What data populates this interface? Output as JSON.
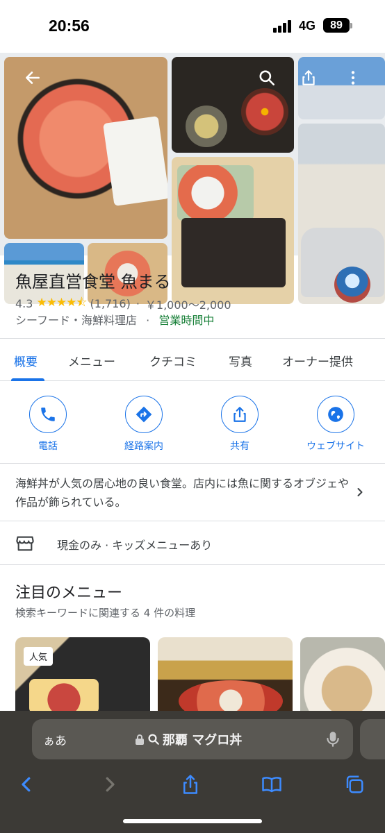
{
  "status": {
    "time": "20:56",
    "network": "4G",
    "battery": "89"
  },
  "place": {
    "name": "魚屋直営食堂 魚まる",
    "rating": "4.3",
    "stars": "★★★★⯪",
    "reviews": "(1,716)",
    "price": "￥1,000〜2,000",
    "category": "シーフード・海鮮料理店",
    "open_status": "営業時間中",
    "sep": "·"
  },
  "tabs": [
    "概要",
    "メニュー",
    "クチコミ",
    "写真",
    "オーナー提供"
  ],
  "actions": [
    "電話",
    "経路案内",
    "共有",
    "ウェブサイト"
  ],
  "description": "海鮮丼が人気の居心地の良い食堂。店内には魚に関するオブジェや作品が飾られている。",
  "amenities": "現金のみ · キッズメニューあり",
  "menu": {
    "title": "注目のメニュー",
    "subtitle": "検索キーワードに関連する 4 件の料理",
    "badge": "人気"
  },
  "browser": {
    "aa": "ぁあ",
    "query": "那覇 マグロ丼"
  },
  "colors": {
    "accent": "#1a73e8",
    "open": "#188038",
    "star": "#fbbc04",
    "toolbar": "#3c3a36"
  }
}
